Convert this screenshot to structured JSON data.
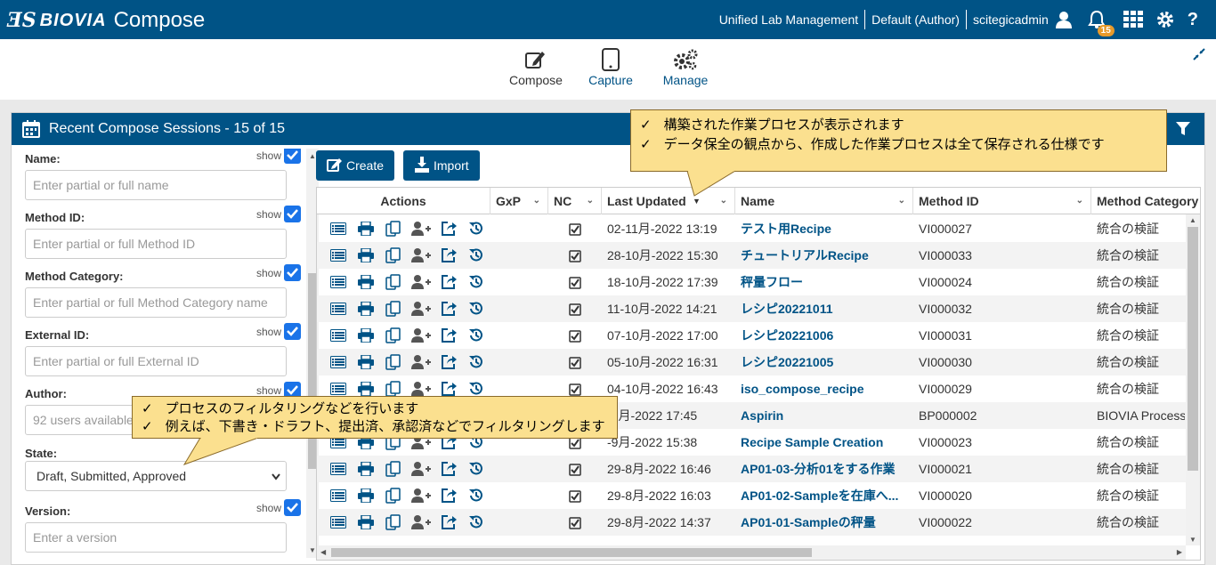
{
  "header": {
    "brand": "BIOVIA",
    "app_name": "Compose",
    "context": "Unified Lab Management",
    "role": "Default (Author)",
    "user": "scitegicadmin",
    "notifications": "15"
  },
  "toolbar": {
    "compose": "Compose",
    "capture": "Capture",
    "manage": "Manage"
  },
  "panel": {
    "title": "Recent Compose Sessions - 15 of 15"
  },
  "filters": {
    "show_label": "show",
    "name_label": "Name:",
    "name_placeholder": "Enter partial or full name",
    "method_id_label": "Method ID:",
    "method_id_placeholder": "Enter partial or full Method ID",
    "method_category_label": "Method Category:",
    "method_category_placeholder": "Enter partial or full Method Category name",
    "external_id_label": "External ID:",
    "external_id_placeholder": "Enter partial or full External ID",
    "author_label": "Author:",
    "author_placeholder": "92 users available",
    "state_label": "State:",
    "state_value": "Draft, Submitted, Approved",
    "version_label": "Version:",
    "version_placeholder": "Enter a version"
  },
  "buttons": {
    "create": "Create",
    "import": "Import"
  },
  "grid": {
    "columns": [
      "Actions",
      "GxP",
      "NC",
      "Last Updated",
      "Name",
      "Method ID",
      "Method Category"
    ],
    "rows": [
      {
        "updated": "02-11月-2022 13:19",
        "name": "テスト用Recipe",
        "method_id": "VI000027",
        "category": "統合の検証"
      },
      {
        "updated": "28-10月-2022 15:30",
        "name": "チュートリアルRecipe",
        "method_id": "VI000033",
        "category": "統合の検証"
      },
      {
        "updated": "18-10月-2022 17:39",
        "name": "秤量フロー",
        "method_id": "VI000024",
        "category": "統合の検証"
      },
      {
        "updated": "11-10月-2022 14:21",
        "name": "レシピ20221011",
        "method_id": "VI000032",
        "category": "統合の検証"
      },
      {
        "updated": "07-10月-2022 17:00",
        "name": "レシピ20221006",
        "method_id": "VI000031",
        "category": "統合の検証"
      },
      {
        "updated": "05-10月-2022 16:31",
        "name": "レシピ20221005",
        "method_id": "VI000030",
        "category": "統合の検証"
      },
      {
        "updated": "04-10月-2022 16:43",
        "name": "iso_compose_recipe",
        "method_id": "VI000029",
        "category": "統合の検証"
      },
      {
        "updated": "-9月-2022 17:45",
        "name": "Aspirin",
        "method_id": "BP000002",
        "category": "BIOVIA Process"
      },
      {
        "updated": "-9月-2022 15:38",
        "name": "Recipe Sample Creation",
        "method_id": "VI000023",
        "category": "統合の検証"
      },
      {
        "updated": "29-8月-2022 16:46",
        "name": "AP01-03-分析01をする作業",
        "method_id": "VI000021",
        "category": "統合の検証"
      },
      {
        "updated": "29-8月-2022 16:03",
        "name": "AP01-02-Sampleを在庫へ...",
        "method_id": "VI000020",
        "category": "統合の検証"
      },
      {
        "updated": "29-8月-2022 14:37",
        "name": "AP01-01-Sampleの秤量",
        "method_id": "VI000022",
        "category": "統合の検証"
      }
    ]
  },
  "callouts": {
    "top": [
      "構築された作業プロセスが表示されます",
      "データ保全の観点から、作成した作業プロセスは全て保存される仕様です"
    ],
    "left": [
      "プロセスのフィルタリングなどを行います",
      "例えば、下書き・ドラフト、提出済、承認済などでフィルタリングします"
    ],
    "check": "✓"
  }
}
